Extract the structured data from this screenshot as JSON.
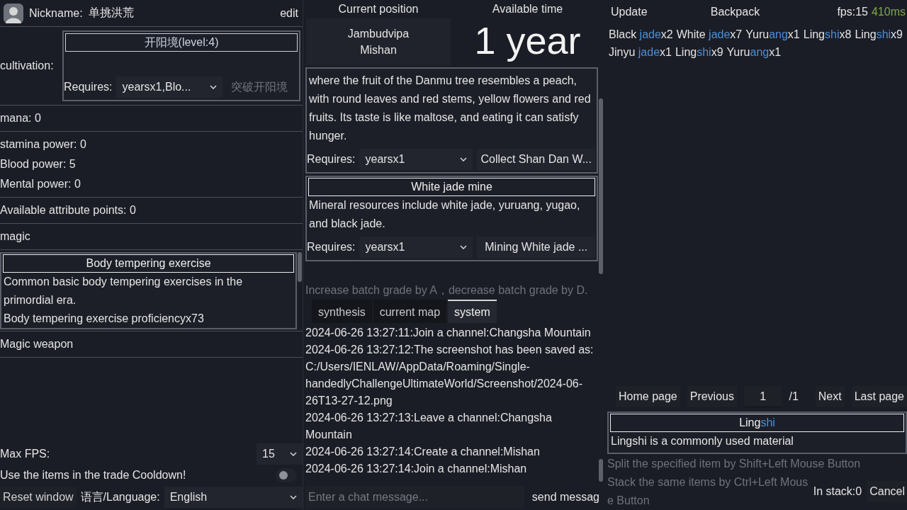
{
  "profile": {
    "nickname_label": "Nickname:",
    "nickname": "单挑洪荒",
    "edit": "edit"
  },
  "cultivation": {
    "label": "cultivation:",
    "realm": "开阳境(level:4)",
    "requires_label": "Requires:",
    "requires": "yearsx1,Blo...",
    "breakthrough": {
      "label": "突破开阳境",
      "disabled": true
    }
  },
  "sections": [
    {
      "lines": [
        "mana: 0"
      ]
    },
    {
      "lines": [
        "stamina power: 0",
        "Blood power: 5",
        "Mental power: 0"
      ]
    },
    {
      "lines": [
        "Available attribute points: 0"
      ]
    }
  ],
  "magic": {
    "title": "magic",
    "items": [
      {
        "title": "Body tempering exercise",
        "description": "Common basic body tempering exercises in the primordial era.",
        "proficiency": "Body tempering exercise proficiencyx73"
      }
    ]
  },
  "magic_weapon": {
    "title": "Magic weapon"
  },
  "settings": {
    "max_fps_label": "Max FPS:",
    "max_fps": "15",
    "cooldown_label": "Use the items in the trade Cooldown!",
    "cooldown_on": false,
    "reset_window": "Reset window",
    "language_label": "语言/Language:",
    "language": "English"
  },
  "location": {
    "label": "Current position",
    "region": "Jambudvipa",
    "place": "Mishan"
  },
  "time": {
    "label": "Available time",
    "value": "1 year"
  },
  "map_actions": [
    {
      "description": "where the fruit of the Danmu tree resembles a peach, with round leaves and red stems, yellow flowers and red fruits.  Its taste is like maltose, and eating it can satisfy hunger.",
      "requires_label": "Requires:",
      "requires": "yearsx1",
      "action": "Collect Shan Dan W..."
    },
    {
      "title": "White jade mine",
      "description": "Mineral resources include white jade, yuruang, yugao, and black jade.",
      "requires_label": "Requires:",
      "requires": "yearsx1",
      "action": "Mining White jade ..."
    }
  ],
  "batch_hint": "Increase batch grade by A，decrease batch grade by D.",
  "chat": {
    "tabs": [
      {
        "label": "synthesis",
        "selected": false
      },
      {
        "label": "current map",
        "selected": false
      },
      {
        "label": "system",
        "selected": true
      }
    ],
    "messages": [
      "2024-06-26 13:27:11:Join a channel:Changsha Mountain",
      "2024-06-26 13:27:12:The screenshot has been saved as: C:/Users/IENLAW/AppData/Roaming/Single-handedlyChallengeUltimateWorld/Screenshot/2024-06-26T13-27-12.png",
      "2024-06-26 13:27:13:Leave a channel:Changsha Mountain",
      "2024-06-26 13:27:14:Create a channel:Mishan",
      "2024-06-26 13:27:14:Join a channel:Mishan"
    ],
    "placeholder": "Enter a chat message...",
    "send": "send messag"
  },
  "backpack": {
    "update": "Update",
    "title": "Backpack",
    "fps": "fps:15",
    "latency": "410ms",
    "items": [
      {
        "name": "Black jade",
        "count": "x2"
      },
      {
        "name": "White jade",
        "count": "x7"
      },
      {
        "name": "Yuruang",
        "count": "x1"
      },
      {
        "name": "Lingshi",
        "count": "x8"
      },
      {
        "name": "Lingshi",
        "count": "x9"
      },
      {
        "name": "Jinyu jade",
        "count": "x1"
      },
      {
        "name": "Lingshi",
        "count": "x9"
      },
      {
        "name": "Yuruang",
        "count": "x1"
      }
    ],
    "pagination": {
      "home": "Home page",
      "previous": "Previous",
      "page": "1",
      "total": "/1",
      "next": "Next",
      "last": "Last page"
    },
    "detail": {
      "title": "Lingshi",
      "description": "Lingshi is a commonly used material"
    },
    "hints": [
      "Split the specified item by Shift+Left Mouse Button",
      "Stack the same items by Ctrl+Left Mouse Button"
    ],
    "in_stack": "In stack:0",
    "cancel": "Cancel"
  }
}
